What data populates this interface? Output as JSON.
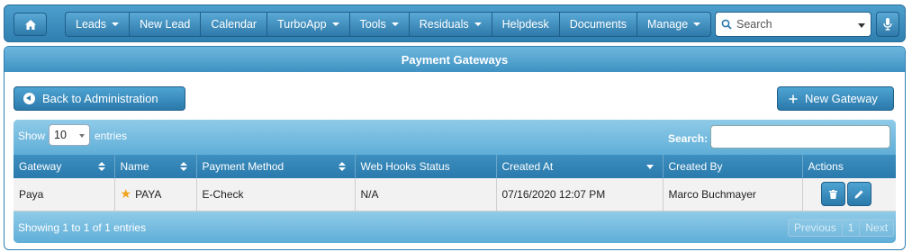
{
  "nav": {
    "home_icon": "home-icon",
    "items": [
      {
        "label": "Leads",
        "dropdown": true
      },
      {
        "label": "New Lead",
        "dropdown": false
      },
      {
        "label": "Calendar",
        "dropdown": false
      },
      {
        "label": "TurboApp",
        "dropdown": true
      },
      {
        "label": "Tools",
        "dropdown": true
      },
      {
        "label": "Residuals",
        "dropdown": true
      },
      {
        "label": "Helpdesk",
        "dropdown": false
      },
      {
        "label": "Documents",
        "dropdown": false
      },
      {
        "label": "Manage",
        "dropdown": true
      }
    ],
    "search_placeholder": "Search",
    "mic_icon": "microphone-icon"
  },
  "panel": {
    "title": "Payment Gateways",
    "back_button": "Back to Administration",
    "new_button": "New Gateway"
  },
  "table": {
    "show_label": "Show",
    "page_size": "10",
    "entries_label": "entries",
    "search_label": "Search:",
    "columns": [
      "Gateway",
      "Name",
      "Payment Method",
      "Web Hooks Status",
      "Created At",
      "Created By",
      "Actions"
    ],
    "rows": [
      {
        "gateway": "Paya",
        "name": "PAYA",
        "starred": true,
        "payment_method": "E-Check",
        "web_hooks_status": "N/A",
        "created_at": "07/16/2020 12:07 PM",
        "created_by": "Marco Buchmayer"
      }
    ],
    "footer_info": "Showing 1 to 1 of 1 entries",
    "pagination": {
      "previous": "Previous",
      "page": "1",
      "next": "Next"
    }
  },
  "colors": {
    "nav_blue": "#2f7fb0",
    "header_blue": "#3f92c2",
    "table_header": "#2a7aad",
    "star": "#f0a21a"
  }
}
